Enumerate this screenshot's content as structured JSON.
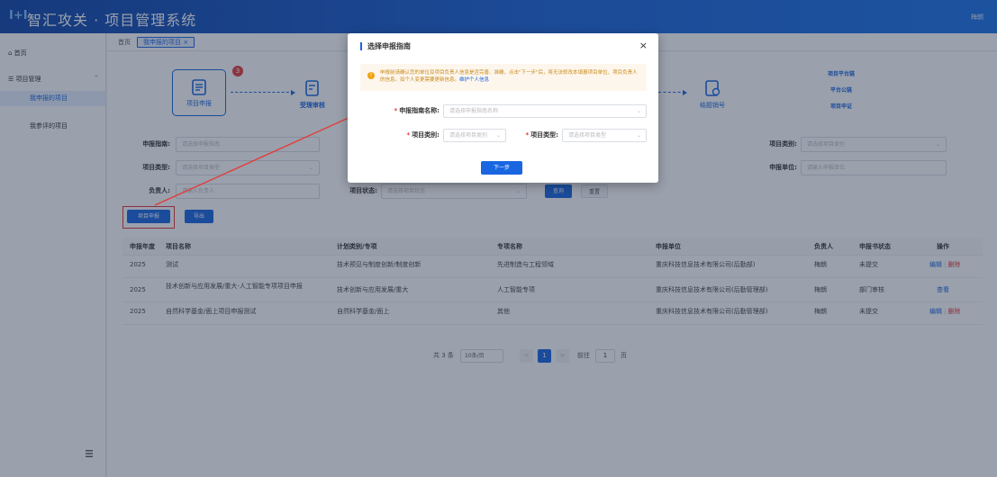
{
  "header": {
    "logo": "I+I",
    "title": "智汇攻关 · 项目管理系统",
    "user": "梅朗"
  },
  "sidebar": {
    "home": "首页",
    "group": "项目管理",
    "items": [
      {
        "label": "我申报的项目"
      },
      {
        "label": "我参评的项目"
      }
    ]
  },
  "tabs": {
    "home": "首页",
    "current": "我申报的项目 ×"
  },
  "flow": {
    "step1": "项目申报",
    "step1_badge": "3",
    "step2": "受理审核",
    "step3": "结题销号",
    "links": [
      "项目平台链",
      "平台公链",
      "项目申证"
    ]
  },
  "filters": {
    "guide_label": "申报指南:",
    "guide_ph": "请选择申报指南",
    "type_label": "项目类型:",
    "type_ph": "请选择项目类型",
    "person_label": "负责人:",
    "person_ph": "请输入负责人",
    "status_label": "项目状态:",
    "status_ph": "请选择项目状态",
    "cat_label": "项目类别:",
    "cat_ph": "请选择项目类别",
    "unit_label": "申报单位:",
    "unit_ph": "请输入申报单位",
    "query": "查询",
    "reset": "重置"
  },
  "actions": {
    "apply": "项目申报",
    "export": "导出"
  },
  "table": {
    "headers": [
      "申报年度",
      "项目名称",
      "计划类别/专项",
      "专项名称",
      "申报单位",
      "负责人",
      "申报书状态",
      "操作"
    ],
    "rows": [
      {
        "year": "2025",
        "name": "测试",
        "plan": "技术预见与制度创新/制度创新",
        "special": "先进制造与工程领域",
        "unit": "重庆科技信息技术有限公司(后勤部)",
        "person": "梅朗",
        "status": "未提交",
        "op1": "编辑",
        "op2": "删除"
      },
      {
        "year": "2025",
        "name": "技术创新与应用发展/重大-人工智能专项项目申报",
        "plan": "技术创新与应用发展/重大",
        "special": "人工智能专项",
        "unit": "重庆科技信息技术有限公司(后勤管理部)",
        "person": "梅朗",
        "status": "部门审核",
        "op1": "查看",
        "op2": ""
      },
      {
        "year": "2025",
        "name": "自然科学基金/面上项目申报测试",
        "plan": "自然科学基金/面上",
        "special": "其他",
        "unit": "重庆科技信息技术有限公司(后勤管理部)",
        "person": "梅朗",
        "status": "未提交",
        "op1": "编辑",
        "op2": "删除"
      }
    ]
  },
  "pagination": {
    "total": "共 3 条",
    "size": "10条/页",
    "prev": "<",
    "current": "1",
    "next": ">",
    "goto": "前往",
    "page": "1",
    "unit": "页"
  },
  "modal": {
    "title": "选择申报指南",
    "close": "×",
    "notice": "申报前请确认您的单位及项目负责人信息是否完善、准确，点击\"下一步\"后，将无法修改本填报项目单位、项目负责人的信息。如个人变更需要更新信息。",
    "notice_link": "维护个人信息",
    "guide_label": "申报指南名称:",
    "guide_ph": "请选择申报指南名称",
    "cat_label": "项目类别:",
    "cat_ph": "请选择项目类别",
    "type_label": "项目类型:",
    "type_ph": "请选择项目类型",
    "next": "下一步",
    "required": "*",
    "dd": "⌄"
  },
  "colors": {
    "primary": "#1966e0",
    "danger": "#e53935",
    "header_start": "#0f45a8",
    "header_end": "#1a73e8"
  }
}
